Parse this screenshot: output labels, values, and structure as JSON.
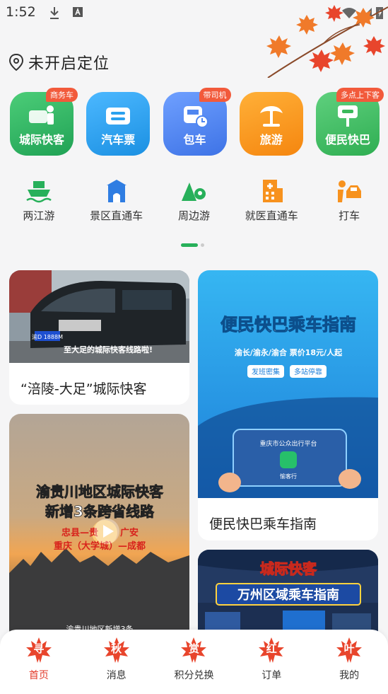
{
  "status_bar": {
    "time": "1:52"
  },
  "location": {
    "text": "未开启定位"
  },
  "main_services": [
    {
      "label": "城际快客",
      "badge": "商务车",
      "color": "#2fb764"
    },
    {
      "label": "汽车票",
      "badge": "",
      "color": "#2aa1ef"
    },
    {
      "label": "包车",
      "badge": "带司机",
      "color": "#4f86f0"
    },
    {
      "label": "旅游",
      "badge": "",
      "color": "#f7921e"
    },
    {
      "label": "便民快巴",
      "badge": "多点上下客",
      "color": "#3bb95b"
    }
  ],
  "sub_services": [
    {
      "label": "两江游",
      "icon": "boat-icon"
    },
    {
      "label": "景区直通车",
      "icon": "gate-icon"
    },
    {
      "label": "周边游",
      "icon": "mountain-pin-icon"
    },
    {
      "label": "就医直通车",
      "icon": "hospital-icon"
    },
    {
      "label": "打车",
      "icon": "taxi-icon"
    }
  ],
  "feed": {
    "card1": {
      "title": "“涪陵-大足”城际快客",
      "image_caption": "至大足的城际快客线路啦!",
      "plate": "渝D 1888M"
    },
    "card2": {
      "title": "便民快巴乘车指南",
      "image_heading": "便民快巴乘车指南",
      "image_sub": "渝长/渝永/渝合  票价18元/人起",
      "tag1": "发班密集",
      "tag2": "多站停靠",
      "screen_text": "重庆市公众出行平台",
      "app_name": "愉客行"
    },
    "card3": {
      "image_heading_1": "渝贵川地区城际快客",
      "image_heading_2": "新增3条跨省线路",
      "route1_a": "忠县—贵",
      "route1_b": "广安",
      "route2": "重庆（大学城）—成都",
      "bottom_text": "渝贵川地区新增3条"
    },
    "card4": {
      "image_heading_1": "城际快客",
      "image_heading_2": "万州区域乘车指南"
    }
  },
  "bottom_nav": [
    {
      "label": "首页",
      "leaf_char": "寻",
      "active": true
    },
    {
      "label": "消息",
      "leaf_char": "秋",
      "active": false
    },
    {
      "label": "积分兑换",
      "leaf_char": "赏",
      "active": false
    },
    {
      "label": "订单",
      "leaf_char": "红",
      "active": false
    },
    {
      "label": "我的",
      "leaf_char": "叶",
      "active": false
    }
  ],
  "colors": {
    "accent": "#27b05a",
    "nav_active": "#e23a2a",
    "leaf": "#e8452c"
  }
}
